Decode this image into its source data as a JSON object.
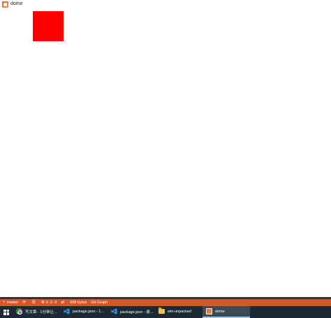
{
  "window": {
    "title": "dome"
  },
  "canvas": {
    "box_color": "#ff0000"
  },
  "colors": {
    "statusbar_bg": "#d0592a",
    "taskbar_bg": "#1d2a35",
    "taskbar_active_bg": "#3c4a56"
  },
  "statusbar": {
    "branch": "master",
    "errors": "0",
    "warnings": "0",
    "file_size": "666 bytes",
    "git_graph": "Git Graph"
  },
  "taskbar": {
    "items": [
      {
        "label": "写文章 - 1分钟让...",
        "icon": "chrome-icon"
      },
      {
        "label": "package.json - 1...",
        "icon": "vscode-icon"
      },
      {
        "label": "package.json - 桌...",
        "icon": "vscode-icon"
      },
      {
        "label": "win-unpacked",
        "icon": "folder-icon"
      },
      {
        "label": "dome",
        "icon": "app-icon",
        "active": true
      }
    ]
  }
}
